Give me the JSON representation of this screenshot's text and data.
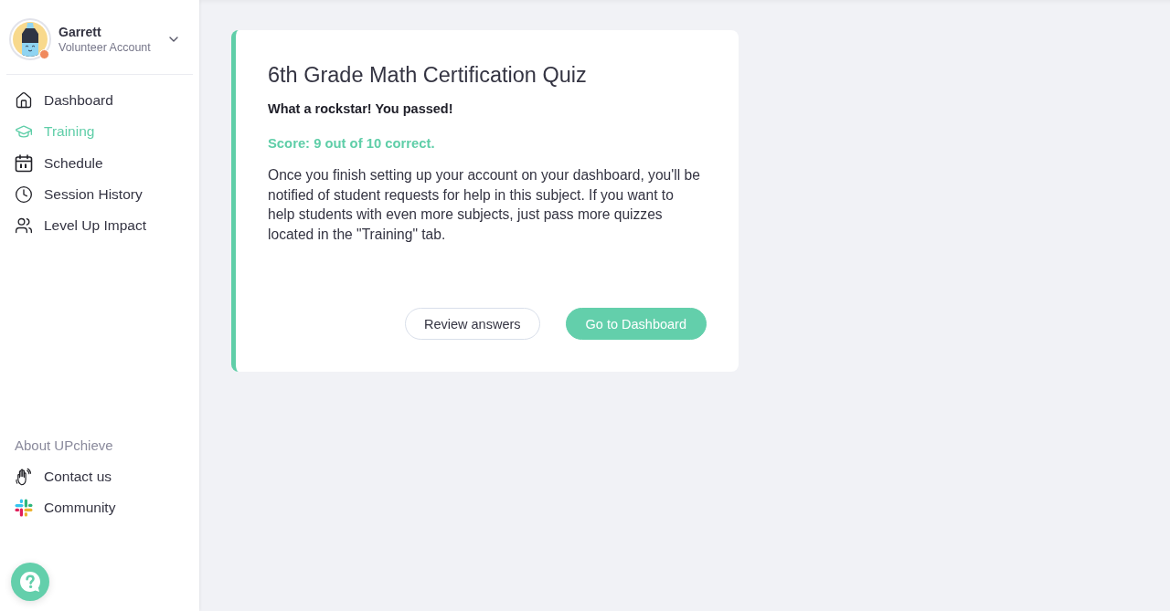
{
  "sidebar": {
    "profile": {
      "name": "Garrett",
      "account_type": "Volunteer Account"
    },
    "nav_items": [
      {
        "label": "Dashboard",
        "selected": false
      },
      {
        "label": "Training",
        "selected": true
      },
      {
        "label": "Schedule",
        "selected": false
      },
      {
        "label": "Session History",
        "selected": false
      },
      {
        "label": "Level Up Impact",
        "selected": false
      }
    ],
    "about": {
      "heading": "About UPchieve",
      "links": [
        {
          "label": "Contact us"
        },
        {
          "label": "Community"
        }
      ]
    }
  },
  "quiz_result": {
    "title": "6th Grade Math Certification Quiz",
    "message": "What a rockstar! You passed!",
    "score": "Score: 9 out of 10 correct.",
    "body": "Once you finish setting up your account on your dashboard, you'll be notified of student requests for help in this subject. If you want to help students with even more subjects, just pass more quizzes located in the \"Training\" tab.",
    "buttons": [
      {
        "label": "Review answers",
        "kind": "secondary"
      },
      {
        "label": "Go to Dashboard",
        "kind": "primary"
      }
    ]
  }
}
